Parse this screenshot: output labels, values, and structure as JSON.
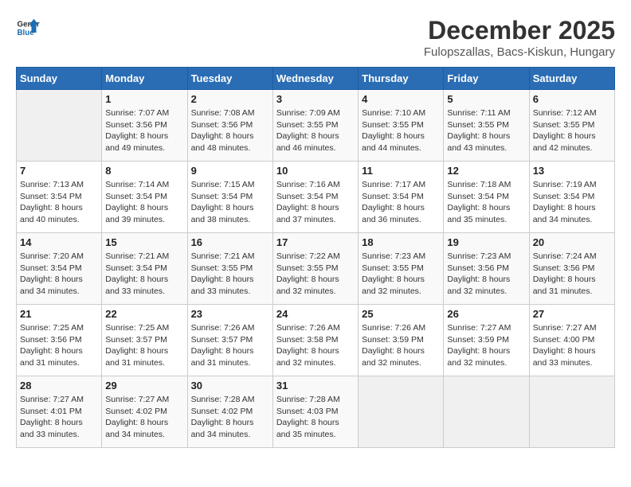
{
  "header": {
    "logo_general": "General",
    "logo_blue": "Blue",
    "title": "December 2025",
    "subtitle": "Fulopszallas, Bacs-Kiskun, Hungary"
  },
  "days_of_week": [
    "Sunday",
    "Monday",
    "Tuesday",
    "Wednesday",
    "Thursday",
    "Friday",
    "Saturday"
  ],
  "weeks": [
    [
      {
        "day": "",
        "info": ""
      },
      {
        "day": "1",
        "info": "Sunrise: 7:07 AM\nSunset: 3:56 PM\nDaylight: 8 hours\nand 49 minutes."
      },
      {
        "day": "2",
        "info": "Sunrise: 7:08 AM\nSunset: 3:56 PM\nDaylight: 8 hours\nand 48 minutes."
      },
      {
        "day": "3",
        "info": "Sunrise: 7:09 AM\nSunset: 3:55 PM\nDaylight: 8 hours\nand 46 minutes."
      },
      {
        "day": "4",
        "info": "Sunrise: 7:10 AM\nSunset: 3:55 PM\nDaylight: 8 hours\nand 44 minutes."
      },
      {
        "day": "5",
        "info": "Sunrise: 7:11 AM\nSunset: 3:55 PM\nDaylight: 8 hours\nand 43 minutes."
      },
      {
        "day": "6",
        "info": "Sunrise: 7:12 AM\nSunset: 3:55 PM\nDaylight: 8 hours\nand 42 minutes."
      }
    ],
    [
      {
        "day": "7",
        "info": "Sunrise: 7:13 AM\nSunset: 3:54 PM\nDaylight: 8 hours\nand 40 minutes."
      },
      {
        "day": "8",
        "info": "Sunrise: 7:14 AM\nSunset: 3:54 PM\nDaylight: 8 hours\nand 39 minutes."
      },
      {
        "day": "9",
        "info": "Sunrise: 7:15 AM\nSunset: 3:54 PM\nDaylight: 8 hours\nand 38 minutes."
      },
      {
        "day": "10",
        "info": "Sunrise: 7:16 AM\nSunset: 3:54 PM\nDaylight: 8 hours\nand 37 minutes."
      },
      {
        "day": "11",
        "info": "Sunrise: 7:17 AM\nSunset: 3:54 PM\nDaylight: 8 hours\nand 36 minutes."
      },
      {
        "day": "12",
        "info": "Sunrise: 7:18 AM\nSunset: 3:54 PM\nDaylight: 8 hours\nand 35 minutes."
      },
      {
        "day": "13",
        "info": "Sunrise: 7:19 AM\nSunset: 3:54 PM\nDaylight: 8 hours\nand 34 minutes."
      }
    ],
    [
      {
        "day": "14",
        "info": "Sunrise: 7:20 AM\nSunset: 3:54 PM\nDaylight: 8 hours\nand 34 minutes."
      },
      {
        "day": "15",
        "info": "Sunrise: 7:21 AM\nSunset: 3:54 PM\nDaylight: 8 hours\nand 33 minutes."
      },
      {
        "day": "16",
        "info": "Sunrise: 7:21 AM\nSunset: 3:55 PM\nDaylight: 8 hours\nand 33 minutes."
      },
      {
        "day": "17",
        "info": "Sunrise: 7:22 AM\nSunset: 3:55 PM\nDaylight: 8 hours\nand 32 minutes."
      },
      {
        "day": "18",
        "info": "Sunrise: 7:23 AM\nSunset: 3:55 PM\nDaylight: 8 hours\nand 32 minutes."
      },
      {
        "day": "19",
        "info": "Sunrise: 7:23 AM\nSunset: 3:56 PM\nDaylight: 8 hours\nand 32 minutes."
      },
      {
        "day": "20",
        "info": "Sunrise: 7:24 AM\nSunset: 3:56 PM\nDaylight: 8 hours\nand 31 minutes."
      }
    ],
    [
      {
        "day": "21",
        "info": "Sunrise: 7:25 AM\nSunset: 3:56 PM\nDaylight: 8 hours\nand 31 minutes."
      },
      {
        "day": "22",
        "info": "Sunrise: 7:25 AM\nSunset: 3:57 PM\nDaylight: 8 hours\nand 31 minutes."
      },
      {
        "day": "23",
        "info": "Sunrise: 7:26 AM\nSunset: 3:57 PM\nDaylight: 8 hours\nand 31 minutes."
      },
      {
        "day": "24",
        "info": "Sunrise: 7:26 AM\nSunset: 3:58 PM\nDaylight: 8 hours\nand 32 minutes."
      },
      {
        "day": "25",
        "info": "Sunrise: 7:26 AM\nSunset: 3:59 PM\nDaylight: 8 hours\nand 32 minutes."
      },
      {
        "day": "26",
        "info": "Sunrise: 7:27 AM\nSunset: 3:59 PM\nDaylight: 8 hours\nand 32 minutes."
      },
      {
        "day": "27",
        "info": "Sunrise: 7:27 AM\nSunset: 4:00 PM\nDaylight: 8 hours\nand 33 minutes."
      }
    ],
    [
      {
        "day": "28",
        "info": "Sunrise: 7:27 AM\nSunset: 4:01 PM\nDaylight: 8 hours\nand 33 minutes."
      },
      {
        "day": "29",
        "info": "Sunrise: 7:27 AM\nSunset: 4:02 PM\nDaylight: 8 hours\nand 34 minutes."
      },
      {
        "day": "30",
        "info": "Sunrise: 7:28 AM\nSunset: 4:02 PM\nDaylight: 8 hours\nand 34 minutes."
      },
      {
        "day": "31",
        "info": "Sunrise: 7:28 AM\nSunset: 4:03 PM\nDaylight: 8 hours\nand 35 minutes."
      },
      {
        "day": "",
        "info": ""
      },
      {
        "day": "",
        "info": ""
      },
      {
        "day": "",
        "info": ""
      }
    ]
  ]
}
